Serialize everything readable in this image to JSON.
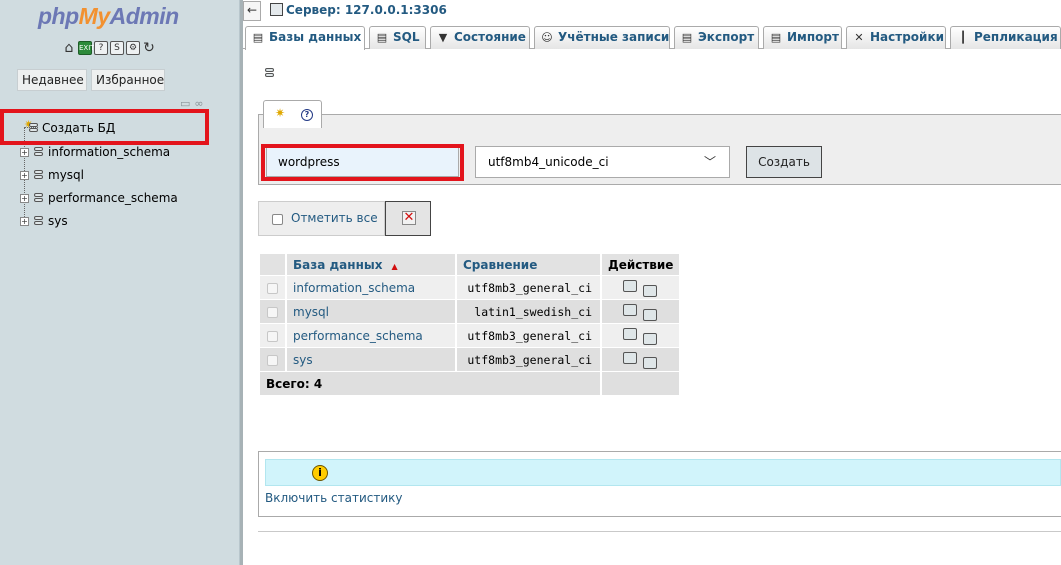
{
  "nav": {
    "logo": {
      "php": "php",
      "my": "My",
      "admin": "Admin"
    },
    "icons": [
      "home-icon",
      "exit-icon",
      "docs-icon",
      "sql-docs-icon",
      "settings-icon",
      "reload-icon"
    ],
    "recent_label": "Недавнее",
    "favorites_label": "Избранное",
    "create_db_label": "Создать БД",
    "databases": [
      "information_schema",
      "mysql",
      "performance_schema",
      "sys"
    ]
  },
  "topbar": {
    "back_label": "←",
    "server_label": "Сервер: 127.0.0.1:3306"
  },
  "tabs": [
    {
      "label": "Базы данных",
      "icon": "databases-icon",
      "active": true
    },
    {
      "label": "SQL",
      "icon": "sql-icon",
      "active": false
    },
    {
      "label": "Состояние",
      "icon": "status-icon",
      "active": false
    },
    {
      "label": "Учётные записи",
      "icon": "accounts-icon",
      "active": false
    },
    {
      "label": "Экспорт",
      "icon": "export-icon",
      "active": false
    },
    {
      "label": "Импорт",
      "icon": "import-icon",
      "active": false
    },
    {
      "label": "Настройки",
      "icon": "settings-icon",
      "active": false
    },
    {
      "label": "Репликация",
      "icon": "replication-icon",
      "active": false
    }
  ],
  "create_form": {
    "db_name_value": "wordpress",
    "collation_value": "utf8mb4_unicode_ci",
    "create_button_label": "Создать"
  },
  "check_all_label": "Отметить все",
  "table": {
    "headers": {
      "name": "База данных",
      "collation": "Сравнение",
      "action": "Действие"
    },
    "rows": [
      {
        "name": "information_schema",
        "collation": "utf8mb3_general_ci"
      },
      {
        "name": "mysql",
        "collation": "latin1_swedish_ci"
      },
      {
        "name": "performance_schema",
        "collation": "utf8mb3_general_ci"
      },
      {
        "name": "sys",
        "collation": "utf8mb3_general_ci"
      }
    ],
    "total_label": "Всего: 4"
  },
  "stats": {
    "enable_label": "Включить статистику"
  },
  "colors": {
    "link": "#235a81",
    "nav_bg": "#d0dce0",
    "highlight": "#e3141c",
    "notice_bg": "#d1f4fb"
  }
}
